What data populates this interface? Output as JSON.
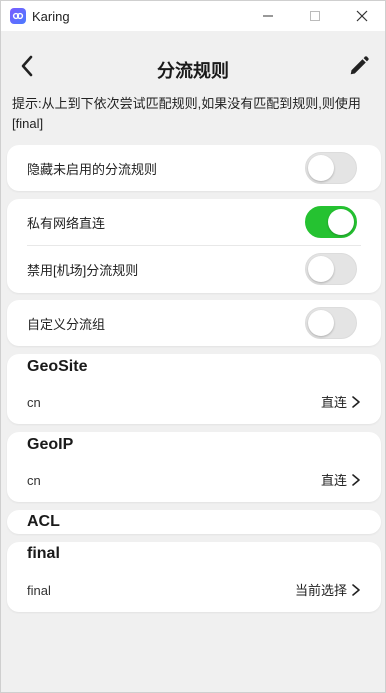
{
  "titlebar": {
    "title": "Karing"
  },
  "header": {
    "title": "分流规则"
  },
  "hint": "提示:从上到下依次尝试匹配规则,如果没有匹配到规则,则使用[final]",
  "settings": {
    "hide_disabled": {
      "label": "隐藏未启用的分流规则",
      "on": false
    },
    "private_direct": {
      "label": "私有网络直连",
      "on": true
    },
    "disable_airport": {
      "label": "禁用[机场]分流规则",
      "on": false
    },
    "custom_group": {
      "label": "自定义分流组",
      "on": false
    }
  },
  "groups": {
    "geosite": {
      "title": "GeoSite",
      "item": "cn",
      "value": "直连"
    },
    "geoip": {
      "title": "GeoIP",
      "item": "cn",
      "value": "直连"
    },
    "acl": {
      "title": "ACL"
    },
    "final": {
      "title": "final",
      "item": "final",
      "value": "当前选择"
    }
  },
  "colors": {
    "toggle_on": "#25c231",
    "toggle_off": "#e4e4e4",
    "background": "#f0f0f0",
    "card": "#ffffff"
  }
}
